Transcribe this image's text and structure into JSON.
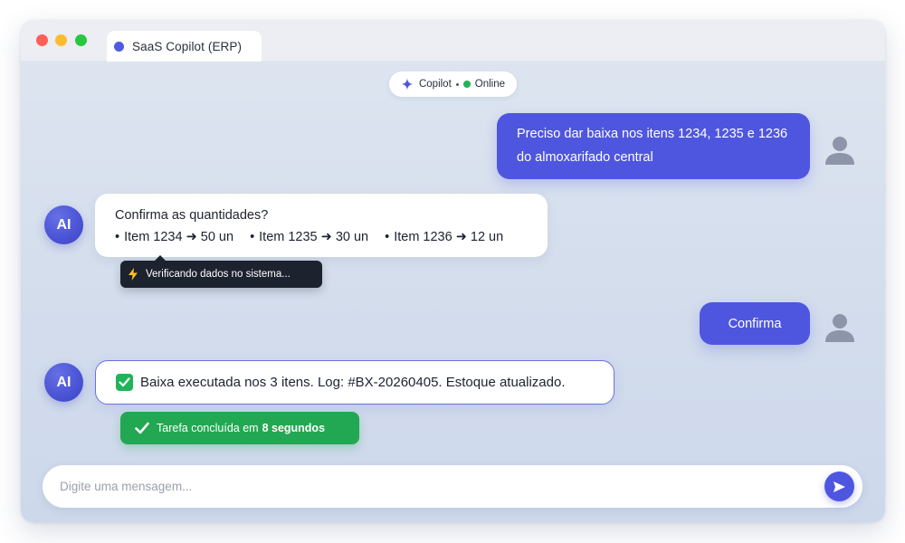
{
  "window": {
    "tab_title": "SaaS Copilot (ERP)"
  },
  "status": {
    "assistant_name": "Copilot",
    "state": "Online"
  },
  "messages": {
    "user1": {
      "line1": "Preciso dar baixa nos itens 1234, 1235 e 1236",
      "line2": "do almoxarifado central"
    },
    "ai1": {
      "avatar": "AI",
      "question": "Confirma as quantidades?",
      "items": [
        "Item 1234 ➜ 50 un",
        "Item 1235 ➜ 30 un",
        "Item 1236 ➜ 12 un"
      ],
      "tooltip": "Verificando dados no sistema..."
    },
    "user2": {
      "text": "Confirma"
    },
    "ai2": {
      "avatar": "AI",
      "text": "Baixa executada nos 3 itens. Log: #BX-20260405. Estoque atualizado.",
      "task_prefix": "Tarefa concluída em",
      "task_duration": "8 segundos"
    }
  },
  "composer": {
    "placeholder": "Digite uma mensagem...",
    "send_icon": "send-icon"
  },
  "colors": {
    "accent": "#4e56df",
    "success": "#22a852",
    "online": "#22b35a",
    "tooltip_bg": "#1c222e"
  }
}
